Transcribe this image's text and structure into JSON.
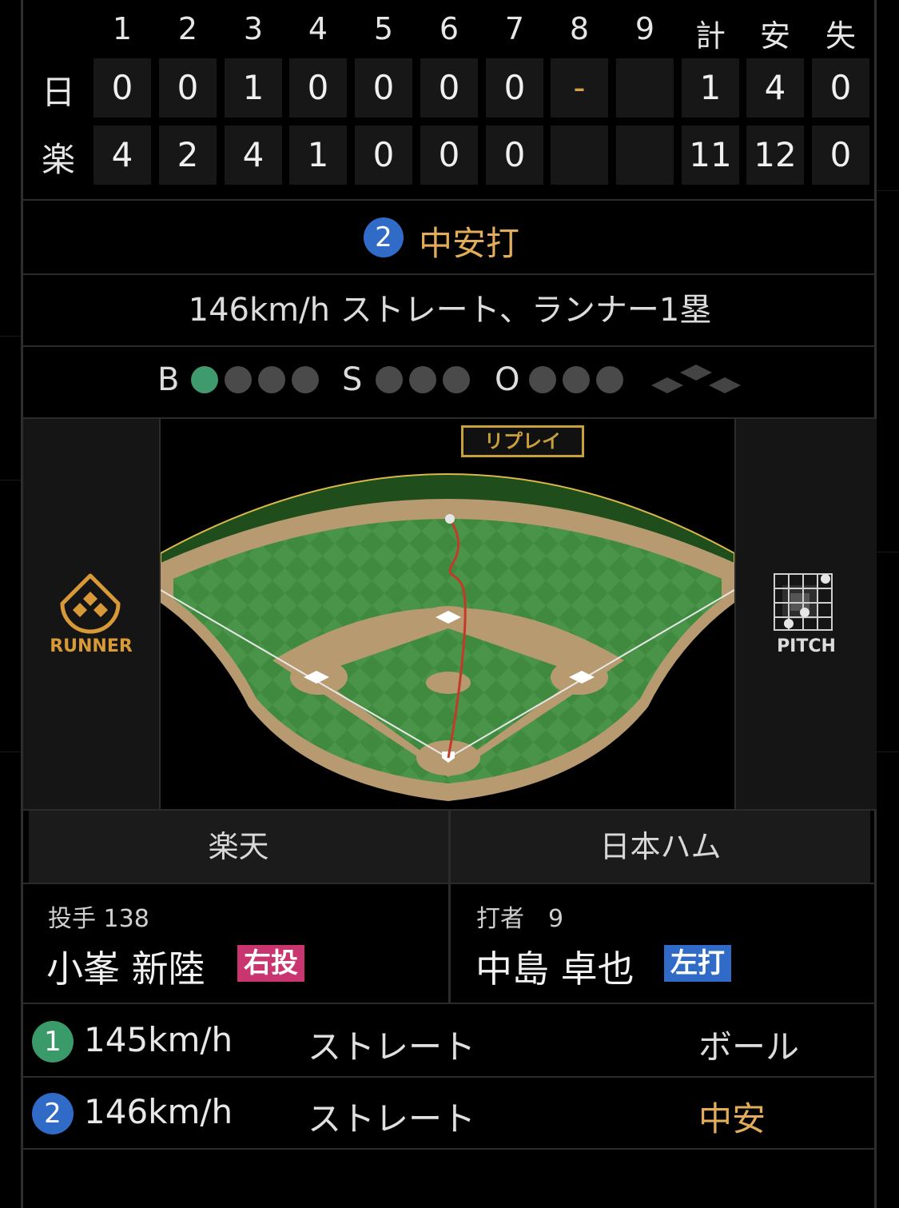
{
  "scoreboard": {
    "innings": [
      "1",
      "2",
      "3",
      "4",
      "5",
      "6",
      "7",
      "8",
      "9"
    ],
    "totals_headers": [
      "計",
      "安",
      "失"
    ],
    "teams": [
      {
        "abbr": "日",
        "innings": [
          "0",
          "0",
          "1",
          "0",
          "0",
          "0",
          "0",
          "-",
          ""
        ],
        "totals": [
          "1",
          "4",
          "0"
        ]
      },
      {
        "abbr": "楽",
        "innings": [
          "4",
          "2",
          "4",
          "1",
          "0",
          "0",
          "0",
          "",
          ""
        ],
        "totals": [
          "11",
          "12",
          "0"
        ]
      }
    ]
  },
  "play": {
    "number": "2",
    "title": "中安打",
    "description": "146km/h ストレート、ランナー1塁"
  },
  "count": {
    "balls_label": "B",
    "strikes_label": "S",
    "outs_label": "O",
    "balls": 1,
    "strikes": 0,
    "outs": 0,
    "ball_color": "#3f9a6d"
  },
  "field": {
    "replay_label": "リプレイ",
    "runner_label": "RUNNER",
    "pitch_label": "PITCH"
  },
  "matchup": {
    "pitcher_team": "楽天",
    "batter_team": "日本ハム",
    "pitcher": {
      "role": "投手 138",
      "name": "小峯 新陸",
      "hand": "右投",
      "hand_color": "#c9356f"
    },
    "batter": {
      "role": "打者　9",
      "name": "中島 卓也",
      "hand": "左打",
      "hand_color": "#2f6bc7"
    }
  },
  "pitches": [
    {
      "num": "1",
      "speed": "145km/h",
      "type": "ストレート",
      "result": "ボール",
      "badge_color": "#3a9a6a",
      "result_color": "#dcdcdc"
    },
    {
      "num": "2",
      "speed": "146km/h",
      "type": "ストレート",
      "result": "中安",
      "badge_color": "#2f6bc7",
      "result_color": "#e2ad5a"
    }
  ],
  "colors": {
    "accent": "#e2ad5a",
    "field_green": "#3f8a3f",
    "dirt": "#b79a6f"
  }
}
